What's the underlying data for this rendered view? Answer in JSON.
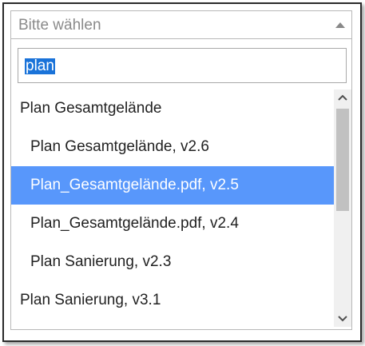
{
  "select": {
    "placeholder": "Bitte wählen",
    "arrow_icon": "triangle-up-icon"
  },
  "search": {
    "value": "plan"
  },
  "options": [
    {
      "label": "Plan Gesamtgelände",
      "type": "group",
      "highlighted": false
    },
    {
      "label": "Plan Gesamtgelände, v2.6",
      "type": "child",
      "highlighted": false
    },
    {
      "label": "Plan_Gesamtgelände.pdf, v2.5",
      "type": "child",
      "highlighted": true
    },
    {
      "label": "Plan_Gesamtgelände.pdf, v2.4",
      "type": "child",
      "highlighted": false
    },
    {
      "label": "Plan Sanierung, v2.3",
      "type": "child",
      "highlighted": false
    },
    {
      "label": "Plan Sanierung, v3.1",
      "type": "group",
      "highlighted": false
    }
  ],
  "colors": {
    "highlight": "#5897fb",
    "selection": "#1a73d9",
    "border": "#b8b8b8"
  }
}
